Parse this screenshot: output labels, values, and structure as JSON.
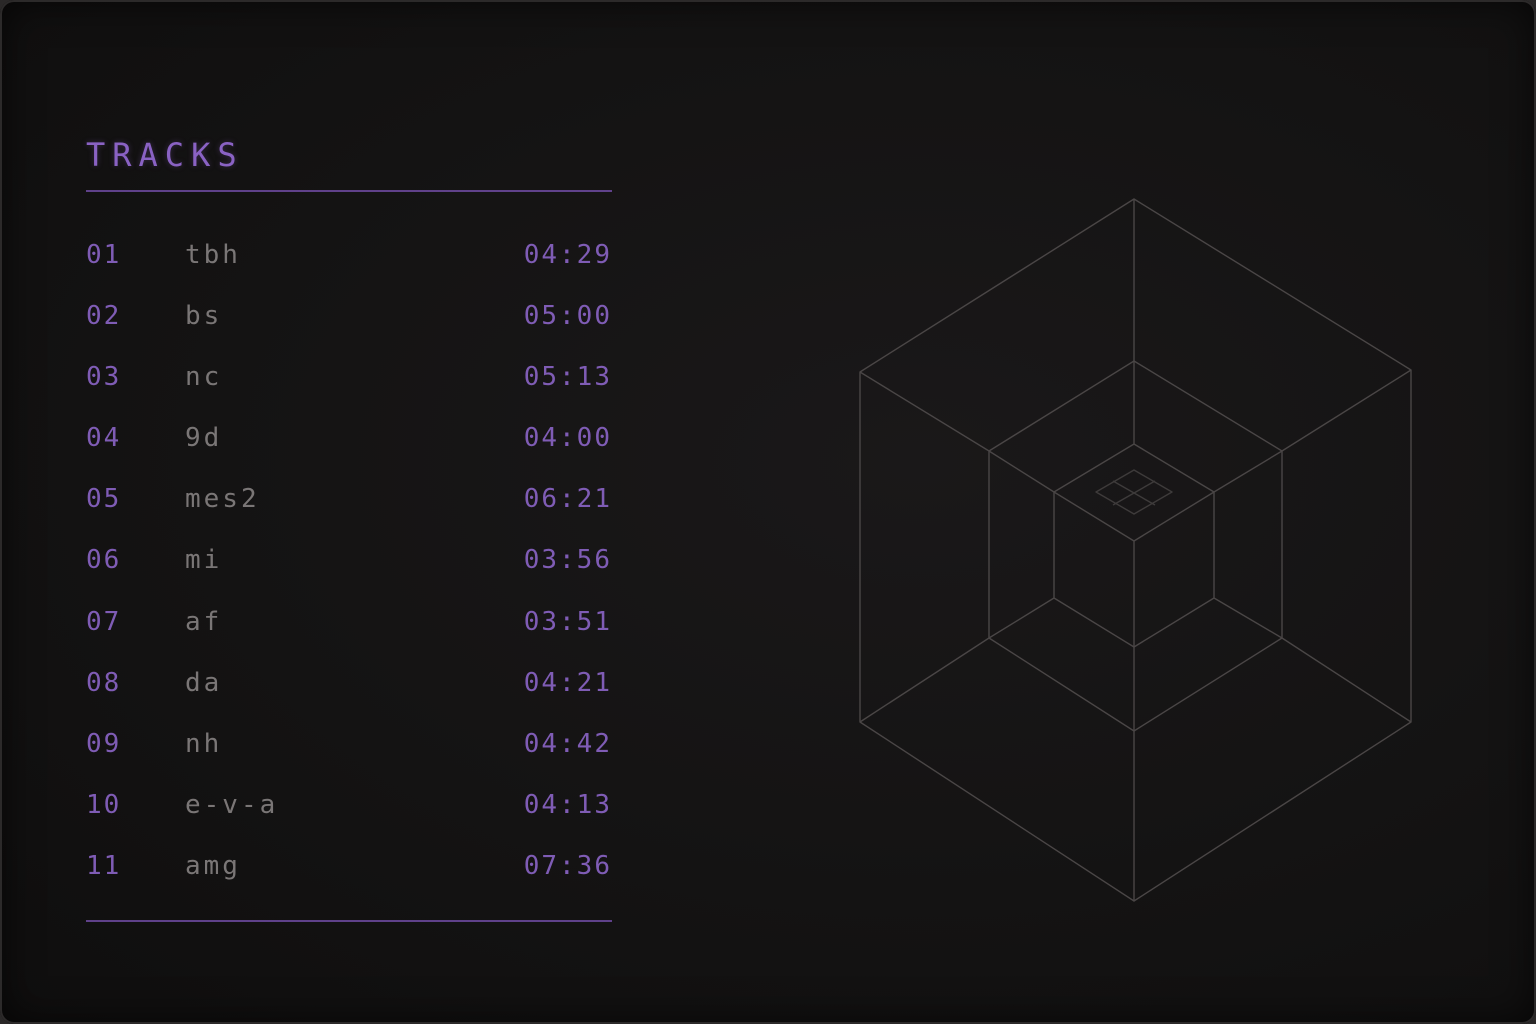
{
  "header": {
    "title": "TRACKS"
  },
  "tracks": [
    {
      "num": "01",
      "name": "tbh",
      "duration": "04:29"
    },
    {
      "num": "02",
      "name": "bs",
      "duration": "05:00"
    },
    {
      "num": "03",
      "name": "nc",
      "duration": "05:13"
    },
    {
      "num": "04",
      "name": "9d",
      "duration": "04:00"
    },
    {
      "num": "05",
      "name": "mes2",
      "duration": "06:21"
    },
    {
      "num": "06",
      "name": "mi",
      "duration": "03:56"
    },
    {
      "num": "07",
      "name": "af",
      "duration": "03:51"
    },
    {
      "num": "08",
      "name": "da",
      "duration": "04:21"
    },
    {
      "num": "09",
      "name": "nh",
      "duration": "04:42"
    },
    {
      "num": "10",
      "name": "e-v-a",
      "duration": "04:13"
    },
    {
      "num": "11",
      "name": "amg",
      "duration": "07:36"
    }
  ],
  "colors": {
    "accent": "#8a62c4",
    "text_muted": "#7a7676",
    "background": "#141313",
    "line_art": "#4a4646"
  },
  "artwork": {
    "icon": "nested-isometric-cube-icon"
  }
}
